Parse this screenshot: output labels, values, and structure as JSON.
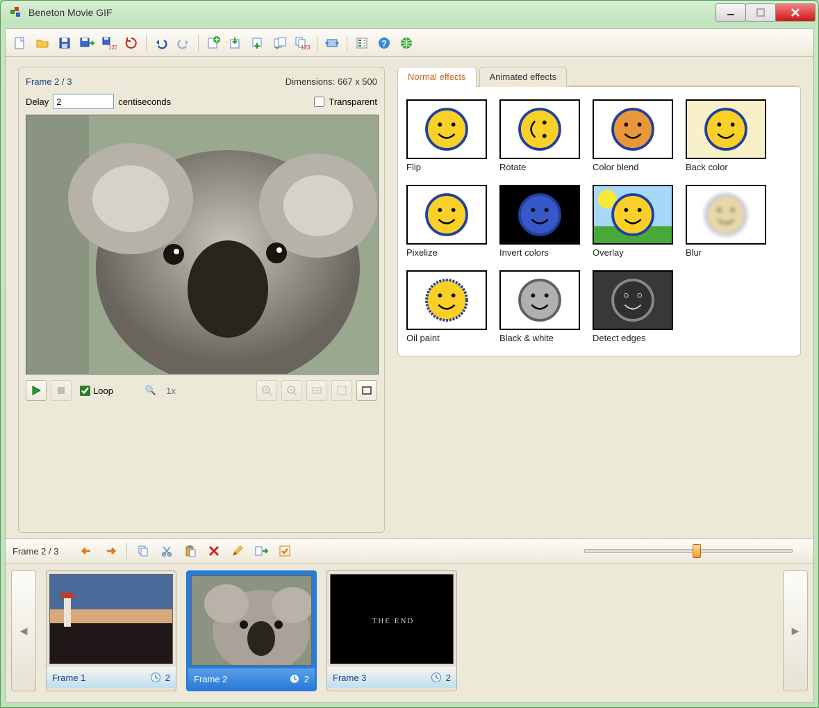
{
  "window": {
    "title": "Beneton Movie GIF"
  },
  "toolbar": {
    "buttons": [
      "new",
      "open",
      "save",
      "save-as",
      "save-frames",
      "refresh",
      "SEP",
      "undo",
      "redo",
      "SEP",
      "add-frame",
      "import-frame",
      "export-frame",
      "replace-frame",
      "reorder-frames",
      "SEP",
      "resize-canvas",
      "SEP",
      "properties",
      "help",
      "web"
    ]
  },
  "preview": {
    "frame_index": "Frame 2 / 3",
    "dimensions": "Dimensions: 667 x 500",
    "delay_label": "Delay",
    "delay_value": "2",
    "delay_unit": "centiseconds",
    "transparent_label": "Transparent",
    "transparent_checked": false,
    "loop_label": "Loop",
    "loop_checked": true,
    "zoom_label": "1x"
  },
  "effects_tabs": {
    "normal": "Normal effects",
    "animated": "Animated effects",
    "active": "normal"
  },
  "effects": [
    {
      "id": "flip",
      "label": "Flip"
    },
    {
      "id": "rotate",
      "label": "Rotate"
    },
    {
      "id": "color-blend",
      "label": "Color blend"
    },
    {
      "id": "back-color",
      "label": "Back color"
    },
    {
      "id": "pixelize",
      "label": "Pixelize"
    },
    {
      "id": "invert-colors",
      "label": "Invert colors"
    },
    {
      "id": "overlay",
      "label": "Overlay"
    },
    {
      "id": "blur",
      "label": "Blur"
    },
    {
      "id": "oil-paint",
      "label": "Oil paint"
    },
    {
      "id": "black-white",
      "label": "Black & white"
    },
    {
      "id": "detect-edges",
      "label": "Detect edges"
    }
  ],
  "timeline": {
    "frame_index": "Frame 2 / 3",
    "buttons": [
      "prev",
      "next",
      "SEP",
      "copy",
      "cut",
      "paste",
      "delete",
      "edit",
      "insert",
      "select-all"
    ],
    "slider_pos": 0.52
  },
  "frames": [
    {
      "label": "Frame 1",
      "delay": "2",
      "selected": false,
      "kind": "sunset"
    },
    {
      "label": "Frame 2",
      "delay": "2",
      "selected": true,
      "kind": "koala"
    },
    {
      "label": "Frame 3",
      "delay": "2",
      "selected": false,
      "kind": "theend"
    }
  ]
}
